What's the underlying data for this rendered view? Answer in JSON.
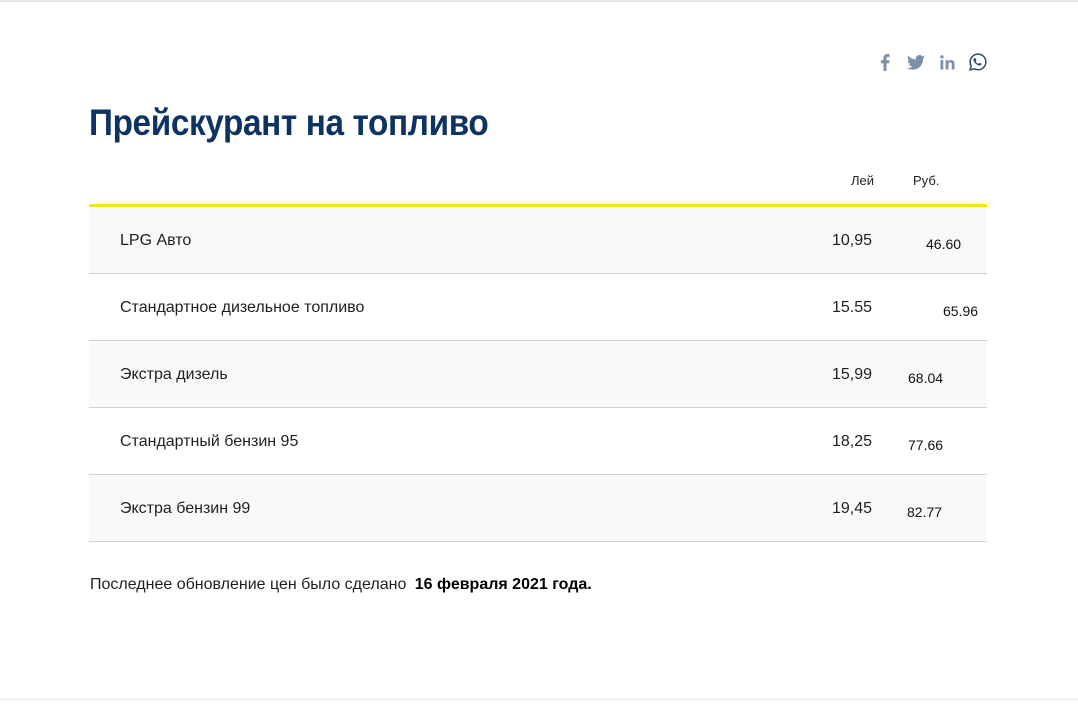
{
  "page": {
    "title": "Прейскурант на топливо"
  },
  "share": {
    "icons": [
      "facebook-icon",
      "twitter-icon",
      "linkedin-icon",
      "whatsapp-icon"
    ],
    "color": "#7c8fa8"
  },
  "table": {
    "headers": {
      "lei": "Лей",
      "rub": "Руб."
    },
    "rows": [
      {
        "name": "LPG Авто",
        "lei": "10,95",
        "rub": "46.60"
      },
      {
        "name": "Стандартное дизельное топливо",
        "lei": "15.55",
        "rub": "65.96"
      },
      {
        "name": "Экстра дизель",
        "lei": "15,99",
        "rub": "68.04"
      },
      {
        "name": "Стандартный бензин 95",
        "lei": "18,25",
        "rub": "77.66"
      },
      {
        "name": "Экстра бензин 99",
        "lei": "19,45",
        "rub": "82.77"
      }
    ]
  },
  "footer": {
    "text": "Последнее обновление цен было сделано ",
    "date": "16 февраля  2021 года."
  },
  "colors": {
    "title": "#0c3363",
    "accent_line": "#f4e40f",
    "row_shade": "#f8f9fa"
  }
}
